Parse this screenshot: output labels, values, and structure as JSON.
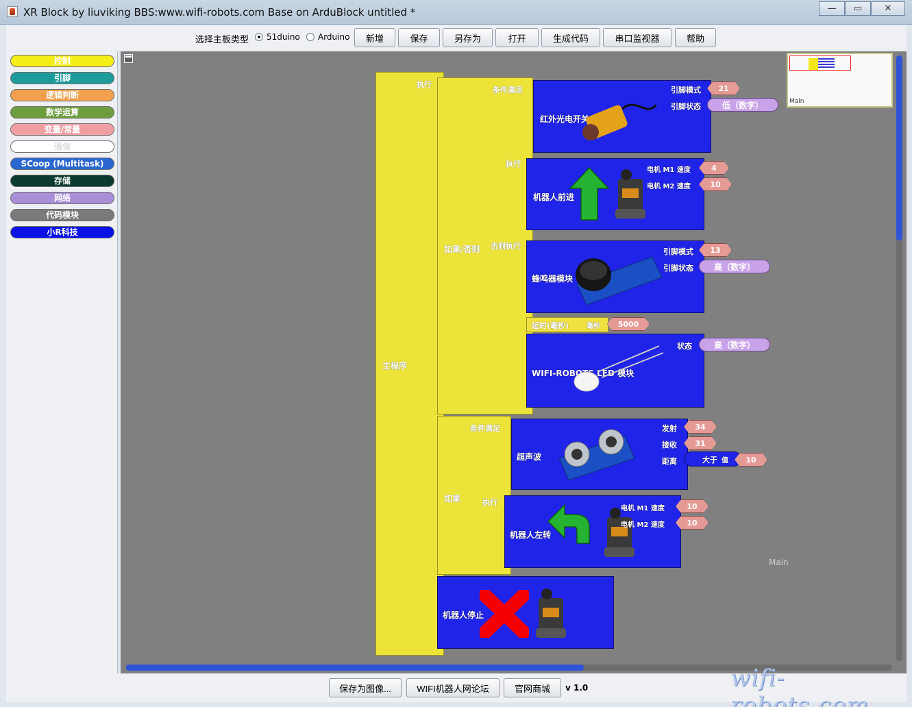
{
  "window": {
    "title": "XR Block by liuviking BBS:www.wifi-robots.com  Base on ArduBlock untitled *",
    "minimize_glyph": "—",
    "maximize_glyph": "▭",
    "close_glyph": "✕"
  },
  "toolbar": {
    "board_label": "选择主板类型",
    "radio_51duino": "51duino",
    "radio_arduino": "Arduino",
    "selected": "51duino",
    "buttons": [
      "新增",
      "保存",
      "另存为",
      "打开",
      "生成代码",
      "串口监视器",
      "帮助"
    ]
  },
  "palette": {
    "items": [
      {
        "label": "控制",
        "color": "#f5ee19",
        "text_color": "#ffffff"
      },
      {
        "label": "引脚",
        "color": "#1e9c9c",
        "text_color": "#ffffff"
      },
      {
        "label": "逻辑判断",
        "color": "#f2a04e",
        "text_color": "#ffffff"
      },
      {
        "label": "数学运算",
        "color": "#6e9d3e",
        "text_color": "#ffffff"
      },
      {
        "label": "变量/常量",
        "color": "#ef9fa2",
        "text_color": "#ffffff"
      },
      {
        "label": "通信",
        "color": "#ffffff",
        "text_color": "#dddddd"
      },
      {
        "label": "SCoop (Multitask)",
        "color": "#2a66d0",
        "text_color": "#ffffff"
      },
      {
        "label": "存储",
        "color": "#0c3a2e",
        "text_color": "#ffffff"
      },
      {
        "label": "网络",
        "color": "#a88fd8",
        "text_color": "#ffffff"
      },
      {
        "label": "代码模块",
        "color": "#7a7a7a",
        "text_color": "#ffffff"
      },
      {
        "label": "小R科技",
        "color": "#0a12e6",
        "text_color": "#ffffff"
      }
    ]
  },
  "canvas": {
    "minimap_label": "Main",
    "canvas_label": "Main",
    "main_program": {
      "label": "主程序",
      "exec_label": "执行"
    },
    "if_else": {
      "label": "如果/否则",
      "cond_label": "条件满足",
      "exec_label": "执行",
      "else_label": "否则执行",
      "sensor": {
        "label": "红外光电开关",
        "pin_mode_label": "引脚模式",
        "pin_mode_value": "21",
        "pin_state_label": "引脚状态",
        "pin_state_value": "低（数字）"
      },
      "forward": {
        "label": "机器人前进",
        "m1_label": "电机 M1 速度",
        "m1_value": "4",
        "m2_label": "电机 M2 速度",
        "m2_value": "10"
      },
      "buzzer": {
        "label": "蜂鸣器模块",
        "pin_mode_label": "引脚模式",
        "pin_mode_value": "13",
        "pin_state_label": "引脚状态",
        "pin_state_value": "高（数字）"
      },
      "delay": {
        "label": "延时(毫秒)",
        "unit_label": "毫秒",
        "value": "5000"
      },
      "led": {
        "label": "WIFI-ROBOTS LED 模块",
        "state_label": "状态",
        "state_value": "高（数字）"
      }
    },
    "if_block": {
      "label": "如果",
      "cond_label": "条件满足",
      "exec_label": "执行",
      "ultrasonic": {
        "label": "超声波",
        "trig_label": "发射",
        "trig_value": "34",
        "echo_label": "接收",
        "echo_value": "31",
        "dist_label": "距离",
        "cmp_label": "大于",
        "val_label": "值",
        "val_value": "10"
      },
      "left": {
        "label": "机器人左转",
        "m1_label": "电机 M1 速度",
        "m1_value": "10",
        "m2_label": "电机 M2 速度",
        "m2_value": "10"
      }
    },
    "stop": {
      "label": "机器人停止"
    }
  },
  "footer": {
    "buttons": [
      "保存为图像...",
      "WIFI机器人网论坛",
      "官网商城"
    ],
    "version": "v 1.0",
    "watermark": "wifi-robots.com"
  },
  "colors": {
    "canvas_bg": "#808080",
    "block_blue": "#2024e8",
    "block_yellow": "#ede43a",
    "value_pink": "#e59a95",
    "value_purple": "#c9a3ea"
  }
}
